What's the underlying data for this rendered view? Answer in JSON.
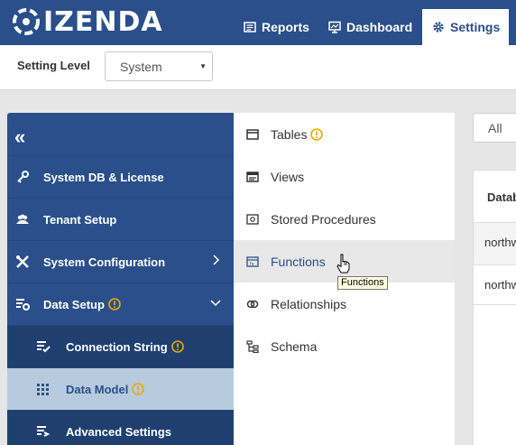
{
  "brand": {
    "name": "IZENDA"
  },
  "nav": {
    "reports": "Reports",
    "dashboard": "Dashboard",
    "settings": "Settings"
  },
  "level": {
    "label": "Setting Level",
    "value": "System"
  },
  "sidebar": {
    "items": [
      {
        "label": "System DB & License",
        "icon": "key-icon"
      },
      {
        "label": "Tenant Setup",
        "icon": "users-icon"
      },
      {
        "label": "System Configuration",
        "icon": "tools-icon"
      },
      {
        "label": "Data Setup",
        "icon": "data-setup-icon"
      },
      {
        "label": "Connection String",
        "icon": "connection-icon"
      },
      {
        "label": "Data Model",
        "icon": "grid-icon"
      },
      {
        "label": "Advanced Settings",
        "icon": "advanced-icon"
      }
    ]
  },
  "menu": {
    "items": [
      {
        "label": "Tables",
        "icon": "table-icon"
      },
      {
        "label": "Views",
        "icon": "view-icon"
      },
      {
        "label": "Stored Procedures",
        "icon": "stored-procedure-icon"
      },
      {
        "label": "Functions",
        "icon": "function-icon"
      },
      {
        "label": "Relationships",
        "icon": "relationship-icon"
      },
      {
        "label": "Schema",
        "icon": "schema-icon"
      }
    ],
    "tooltip": "Functions"
  },
  "filter": {
    "value": "All"
  },
  "grid": {
    "header": "Datab",
    "rows": [
      "northw",
      "northw"
    ]
  },
  "colors": {
    "primary": "#2a4f8a",
    "active_bg": "#b6cbde",
    "warning": "#f0a800"
  }
}
